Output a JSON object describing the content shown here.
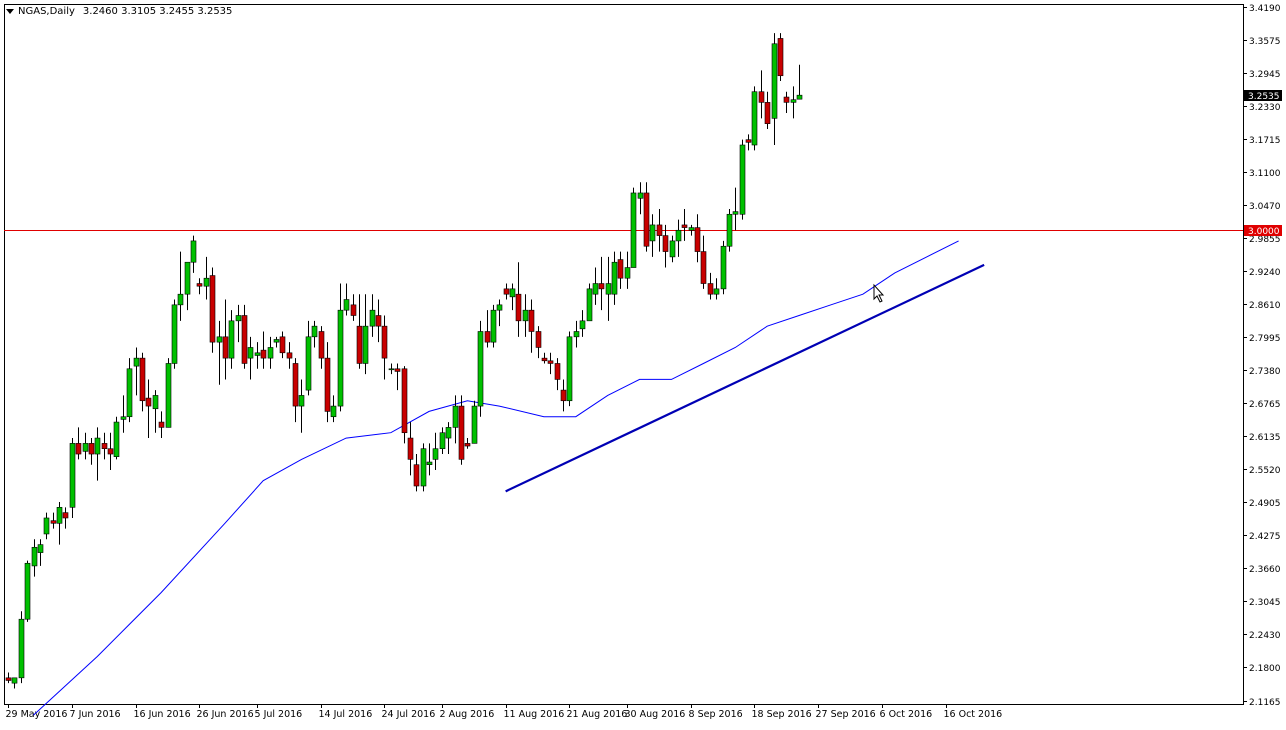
{
  "header": {
    "symbol": "NGAS,Daily",
    "ohlc": "3.2460 3.3105 3.2455 3.2535"
  },
  "colors": {
    "up": "#00c000",
    "down": "#c80000",
    "wick": "#000000",
    "ma": "#0000ff",
    "trend": "#0000b4",
    "level": "#e00000",
    "grid_frame": "#000000"
  },
  "chart_data": {
    "type": "candlestick",
    "symbol": "NGAS",
    "timeframe": "Daily",
    "ylim": [
      2.1165,
      3.419
    ],
    "y_ticks": [
      "3.4190",
      "3.3575",
      "3.2945",
      "3.2330",
      "3.1715",
      "3.1100",
      "3.0470",
      "2.9855",
      "2.9240",
      "2.8610",
      "2.7995",
      "2.7380",
      "2.6765",
      "2.6135",
      "2.5520",
      "2.4905",
      "2.4275",
      "2.3660",
      "2.3045",
      "2.2430",
      "2.1800",
      "2.1165"
    ],
    "x_labels": [
      {
        "text": "29 May 2016",
        "index": 0
      },
      {
        "text": "7 Jun 2016",
        "index": 10
      },
      {
        "text": "16 Jun 2016",
        "index": 20
      },
      {
        "text": "26 Jun 2016",
        "index": 30
      },
      {
        "text": "5 Jul 2016",
        "index": 39
      },
      {
        "text": "14 Jul 2016",
        "index": 49
      },
      {
        "text": "24 Jul 2016",
        "index": 59
      },
      {
        "text": "2 Aug 2016",
        "index": 68
      },
      {
        "text": "11 Aug 2016",
        "index": 78
      },
      {
        "text": "21 Aug 2016",
        "index": 88
      },
      {
        "text": "30 Aug 2016",
        "index": 97
      },
      {
        "text": "8 Sep 2016",
        "index": 107
      },
      {
        "text": "18 Sep 2016",
        "index": 117
      },
      {
        "text": "27 Sep 2016",
        "index": 127
      },
      {
        "text": "6 Oct 2016",
        "index": 137
      },
      {
        "text": "16 Oct 2016",
        "index": 147
      }
    ],
    "horizontal_line": {
      "value": 3.0,
      "label": "3.0000"
    },
    "current_price": {
      "value": 3.2535,
      "label": "3.2535"
    },
    "trendline": {
      "from": {
        "index": 78,
        "price": 2.51
      },
      "to": {
        "index": 153,
        "price": 2.935
      }
    },
    "moving_average": [
      [
        4,
        2.09
      ],
      [
        14,
        2.2
      ],
      [
        24,
        2.32
      ],
      [
        34,
        2.45
      ],
      [
        40,
        2.53
      ],
      [
        46,
        2.57
      ],
      [
        53,
        2.61
      ],
      [
        60,
        2.62
      ],
      [
        66,
        2.66
      ],
      [
        72,
        2.68
      ],
      [
        77,
        2.67
      ],
      [
        84,
        2.65
      ],
      [
        89,
        2.65
      ],
      [
        94,
        2.69
      ],
      [
        99,
        2.72
      ],
      [
        104,
        2.72
      ],
      [
        109,
        2.75
      ],
      [
        114,
        2.78
      ],
      [
        119,
        2.82
      ],
      [
        124,
        2.84
      ],
      [
        129,
        2.86
      ],
      [
        134,
        2.88
      ],
      [
        139,
        2.92
      ],
      [
        144,
        2.95
      ],
      [
        149,
        2.98
      ]
    ],
    "candles": [
      {
        "o": 2.16,
        "h": 2.17,
        "l": 2.15,
        "c": 2.155
      },
      {
        "o": 2.15,
        "h": 2.155,
        "l": 2.14,
        "c": 2.16
      },
      {
        "o": 2.16,
        "h": 2.285,
        "l": 2.15,
        "c": 2.27
      },
      {
        "o": 2.27,
        "h": 2.38,
        "l": 2.265,
        "c": 2.375
      },
      {
        "o": 2.37,
        "h": 2.42,
        "l": 2.35,
        "c": 2.405
      },
      {
        "o": 2.395,
        "h": 2.42,
        "l": 2.37,
        "c": 2.41
      },
      {
        "o": 2.43,
        "h": 2.47,
        "l": 2.42,
        "c": 2.46
      },
      {
        "o": 2.455,
        "h": 2.47,
        "l": 2.44,
        "c": 2.45
      },
      {
        "o": 2.45,
        "h": 2.49,
        "l": 2.41,
        "c": 2.48
      },
      {
        "o": 2.47,
        "h": 2.48,
        "l": 2.44,
        "c": 2.46
      },
      {
        "o": 2.48,
        "h": 2.61,
        "l": 2.46,
        "c": 2.6
      },
      {
        "o": 2.6,
        "h": 2.63,
        "l": 2.57,
        "c": 2.58
      },
      {
        "o": 2.585,
        "h": 2.62,
        "l": 2.57,
        "c": 2.6
      },
      {
        "o": 2.6,
        "h": 2.61,
        "l": 2.56,
        "c": 2.58
      },
      {
        "o": 2.58,
        "h": 2.63,
        "l": 2.53,
        "c": 2.61
      },
      {
        "o": 2.6,
        "h": 2.62,
        "l": 2.57,
        "c": 2.59
      },
      {
        "o": 2.59,
        "h": 2.62,
        "l": 2.55,
        "c": 2.58
      },
      {
        "o": 2.575,
        "h": 2.65,
        "l": 2.57,
        "c": 2.64
      },
      {
        "o": 2.645,
        "h": 2.69,
        "l": 2.62,
        "c": 2.65
      },
      {
        "o": 2.65,
        "h": 2.76,
        "l": 2.64,
        "c": 2.74
      },
      {
        "o": 2.745,
        "h": 2.78,
        "l": 2.69,
        "c": 2.76
      },
      {
        "o": 2.76,
        "h": 2.77,
        "l": 2.66,
        "c": 2.68
      },
      {
        "o": 2.685,
        "h": 2.72,
        "l": 2.61,
        "c": 2.67
      },
      {
        "o": 2.665,
        "h": 2.7,
        "l": 2.62,
        "c": 2.69
      },
      {
        "o": 2.64,
        "h": 2.66,
        "l": 2.61,
        "c": 2.63
      },
      {
        "o": 2.63,
        "h": 2.76,
        "l": 2.63,
        "c": 2.75
      },
      {
        "o": 2.75,
        "h": 2.87,
        "l": 2.74,
        "c": 2.86
      },
      {
        "o": 2.86,
        "h": 2.96,
        "l": 2.83,
        "c": 2.88
      },
      {
        "o": 2.88,
        "h": 2.94,
        "l": 2.85,
        "c": 2.94
      },
      {
        "o": 2.94,
        "h": 2.99,
        "l": 2.92,
        "c": 2.98
      },
      {
        "o": 2.9,
        "h": 2.91,
        "l": 2.88,
        "c": 2.895
      },
      {
        "o": 2.895,
        "h": 2.95,
        "l": 2.87,
        "c": 2.91
      },
      {
        "o": 2.915,
        "h": 2.93,
        "l": 2.77,
        "c": 2.79
      },
      {
        "o": 2.79,
        "h": 2.83,
        "l": 2.71,
        "c": 2.8
      },
      {
        "o": 2.8,
        "h": 2.87,
        "l": 2.72,
        "c": 2.76
      },
      {
        "o": 2.76,
        "h": 2.85,
        "l": 2.74,
        "c": 2.83
      },
      {
        "o": 2.83,
        "h": 2.86,
        "l": 2.79,
        "c": 2.84
      },
      {
        "o": 2.84,
        "h": 2.86,
        "l": 2.74,
        "c": 2.75
      },
      {
        "o": 2.76,
        "h": 2.8,
        "l": 2.72,
        "c": 2.78
      },
      {
        "o": 2.765,
        "h": 2.79,
        "l": 2.74,
        "c": 2.77
      },
      {
        "o": 2.775,
        "h": 2.81,
        "l": 2.74,
        "c": 2.76
      },
      {
        "o": 2.76,
        "h": 2.8,
        "l": 2.74,
        "c": 2.78
      },
      {
        "o": 2.79,
        "h": 2.8,
        "l": 2.78,
        "c": 2.795
      },
      {
        "o": 2.8,
        "h": 2.81,
        "l": 2.76,
        "c": 2.77
      },
      {
        "o": 2.77,
        "h": 2.79,
        "l": 2.74,
        "c": 2.76
      },
      {
        "o": 2.75,
        "h": 2.76,
        "l": 2.64,
        "c": 2.67
      },
      {
        "o": 2.67,
        "h": 2.72,
        "l": 2.62,
        "c": 2.69
      },
      {
        "o": 2.7,
        "h": 2.83,
        "l": 2.69,
        "c": 2.8
      },
      {
        "o": 2.8,
        "h": 2.83,
        "l": 2.78,
        "c": 2.82
      },
      {
        "o": 2.81,
        "h": 2.82,
        "l": 2.74,
        "c": 2.76
      },
      {
        "o": 2.76,
        "h": 2.79,
        "l": 2.64,
        "c": 2.66
      },
      {
        "o": 2.65,
        "h": 2.69,
        "l": 2.64,
        "c": 2.67
      },
      {
        "o": 2.67,
        "h": 2.9,
        "l": 2.66,
        "c": 2.85
      },
      {
        "o": 2.85,
        "h": 2.9,
        "l": 2.84,
        "c": 2.87
      },
      {
        "o": 2.86,
        "h": 2.88,
        "l": 2.83,
        "c": 2.84
      },
      {
        "o": 2.82,
        "h": 2.88,
        "l": 2.74,
        "c": 2.75
      },
      {
        "o": 2.75,
        "h": 2.88,
        "l": 2.73,
        "c": 2.82
      },
      {
        "o": 2.82,
        "h": 2.88,
        "l": 2.8,
        "c": 2.85
      },
      {
        "o": 2.84,
        "h": 2.87,
        "l": 2.79,
        "c": 2.82
      },
      {
        "o": 2.82,
        "h": 2.84,
        "l": 2.72,
        "c": 2.76
      },
      {
        "o": 2.74,
        "h": 2.75,
        "l": 2.73,
        "c": 2.74
      },
      {
        "o": 2.74,
        "h": 2.75,
        "l": 2.7,
        "c": 2.735
      },
      {
        "o": 2.74,
        "h": 2.745,
        "l": 2.6,
        "c": 2.62
      },
      {
        "o": 2.61,
        "h": 2.64,
        "l": 2.54,
        "c": 2.57
      },
      {
        "o": 2.56,
        "h": 2.58,
        "l": 2.51,
        "c": 2.52
      },
      {
        "o": 2.52,
        "h": 2.6,
        "l": 2.51,
        "c": 2.59
      },
      {
        "o": 2.56,
        "h": 2.6,
        "l": 2.54,
        "c": 2.565
      },
      {
        "o": 2.57,
        "h": 2.62,
        "l": 2.55,
        "c": 2.59
      },
      {
        "o": 2.59,
        "h": 2.63,
        "l": 2.58,
        "c": 2.62
      },
      {
        "o": 2.61,
        "h": 2.64,
        "l": 2.58,
        "c": 2.63
      },
      {
        "o": 2.63,
        "h": 2.69,
        "l": 2.6,
        "c": 2.67
      },
      {
        "o": 2.67,
        "h": 2.69,
        "l": 2.56,
        "c": 2.57
      },
      {
        "o": 2.6,
        "h": 2.61,
        "l": 2.59,
        "c": 2.595
      },
      {
        "o": 2.6,
        "h": 2.68,
        "l": 2.6,
        "c": 2.67
      },
      {
        "o": 2.67,
        "h": 2.83,
        "l": 2.65,
        "c": 2.81
      },
      {
        "o": 2.81,
        "h": 2.85,
        "l": 2.78,
        "c": 2.79
      },
      {
        "o": 2.79,
        "h": 2.86,
        "l": 2.78,
        "c": 2.85
      },
      {
        "o": 2.85,
        "h": 2.87,
        "l": 2.82,
        "c": 2.86
      },
      {
        "o": 2.89,
        "h": 2.9,
        "l": 2.87,
        "c": 2.88
      },
      {
        "o": 2.875,
        "h": 2.9,
        "l": 2.85,
        "c": 2.89
      },
      {
        "o": 2.88,
        "h": 2.94,
        "l": 2.8,
        "c": 2.83
      },
      {
        "o": 2.83,
        "h": 2.88,
        "l": 2.8,
        "c": 2.85
      },
      {
        "o": 2.85,
        "h": 2.87,
        "l": 2.77,
        "c": 2.81
      },
      {
        "o": 2.81,
        "h": 2.82,
        "l": 2.76,
        "c": 2.78
      },
      {
        "o": 2.76,
        "h": 2.77,
        "l": 2.75,
        "c": 2.755
      },
      {
        "o": 2.755,
        "h": 2.77,
        "l": 2.73,
        "c": 2.75
      },
      {
        "o": 2.75,
        "h": 2.76,
        "l": 2.7,
        "c": 2.72
      },
      {
        "o": 2.7,
        "h": 2.72,
        "l": 2.66,
        "c": 2.68
      },
      {
        "o": 2.68,
        "h": 2.81,
        "l": 2.67,
        "c": 2.8
      },
      {
        "o": 2.8,
        "h": 2.83,
        "l": 2.78,
        "c": 2.81
      },
      {
        "o": 2.815,
        "h": 2.85,
        "l": 2.8,
        "c": 2.83
      },
      {
        "o": 2.83,
        "h": 2.9,
        "l": 2.83,
        "c": 2.89
      },
      {
        "o": 2.88,
        "h": 2.93,
        "l": 2.86,
        "c": 2.9
      },
      {
        "o": 2.9,
        "h": 2.95,
        "l": 2.85,
        "c": 2.89
      },
      {
        "o": 2.88,
        "h": 2.95,
        "l": 2.83,
        "c": 2.9
      },
      {
        "o": 2.88,
        "h": 2.96,
        "l": 2.86,
        "c": 2.94
      },
      {
        "o": 2.945,
        "h": 2.96,
        "l": 2.89,
        "c": 2.91
      },
      {
        "o": 2.91,
        "h": 2.96,
        "l": 2.89,
        "c": 2.93
      },
      {
        "o": 2.93,
        "h": 3.08,
        "l": 2.93,
        "c": 3.07
      },
      {
        "o": 3.06,
        "h": 3.09,
        "l": 3.03,
        "c": 3.07
      },
      {
        "o": 3.07,
        "h": 3.09,
        "l": 2.96,
        "c": 2.97
      },
      {
        "o": 2.98,
        "h": 3.03,
        "l": 2.95,
        "c": 3.01
      },
      {
        "o": 3.01,
        "h": 3.04,
        "l": 2.96,
        "c": 2.99
      },
      {
        "o": 2.99,
        "h": 3.01,
        "l": 2.93,
        "c": 2.96
      },
      {
        "o": 2.95,
        "h": 2.99,
        "l": 2.94,
        "c": 2.98
      },
      {
        "o": 2.98,
        "h": 3.02,
        "l": 2.95,
        "c": 3.0
      },
      {
        "o": 3.01,
        "h": 3.04,
        "l": 2.98,
        "c": 3.005
      },
      {
        "o": 3.0,
        "h": 3.01,
        "l": 2.99,
        "c": 3.005
      },
      {
        "o": 3.005,
        "h": 3.03,
        "l": 2.94,
        "c": 2.96
      },
      {
        "o": 2.96,
        "h": 2.99,
        "l": 2.89,
        "c": 2.9
      },
      {
        "o": 2.9,
        "h": 2.92,
        "l": 2.87,
        "c": 2.88
      },
      {
        "o": 2.88,
        "h": 2.91,
        "l": 2.87,
        "c": 2.89
      },
      {
        "o": 2.89,
        "h": 2.98,
        "l": 2.88,
        "c": 2.97
      },
      {
        "o": 2.97,
        "h": 3.04,
        "l": 2.96,
        "c": 3.03
      },
      {
        "o": 3.03,
        "h": 3.08,
        "l": 3.0,
        "c": 3.035
      },
      {
        "o": 3.03,
        "h": 3.17,
        "l": 3.02,
        "c": 3.16
      },
      {
        "o": 3.17,
        "h": 3.18,
        "l": 3.15,
        "c": 3.165
      },
      {
        "o": 3.16,
        "h": 3.27,
        "l": 3.15,
        "c": 3.26
      },
      {
        "o": 3.26,
        "h": 3.3,
        "l": 3.21,
        "c": 3.24
      },
      {
        "o": 3.24,
        "h": 3.26,
        "l": 3.19,
        "c": 3.2
      },
      {
        "o": 3.21,
        "h": 3.37,
        "l": 3.16,
        "c": 3.35
      },
      {
        "o": 3.36,
        "h": 3.37,
        "l": 3.28,
        "c": 3.29
      },
      {
        "o": 3.25,
        "h": 3.26,
        "l": 3.22,
        "c": 3.24
      },
      {
        "o": 3.24,
        "h": 3.27,
        "l": 3.21,
        "c": 3.245
      },
      {
        "o": 3.246,
        "h": 3.3105,
        "l": 3.2455,
        "c": 3.2535
      }
    ]
  }
}
